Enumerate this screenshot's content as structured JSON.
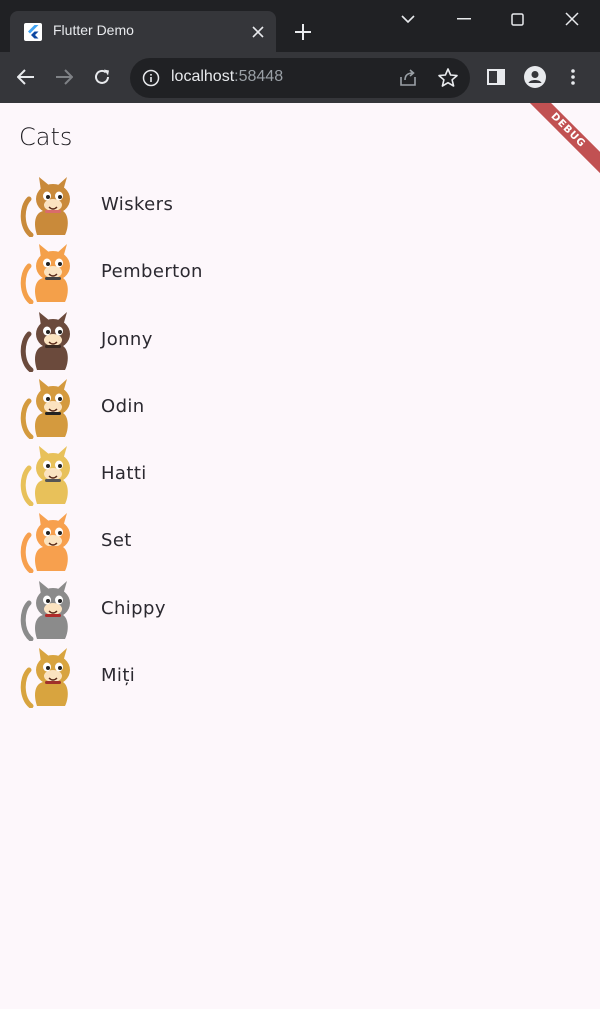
{
  "browser": {
    "tab_title": "Flutter Demo",
    "url_host": "localhost",
    "url_port": ":58448",
    "colors": {
      "frame": "#202124",
      "toolbar": "#35363a",
      "text": "#e8eaed"
    }
  },
  "app": {
    "title": "Cats",
    "debug_banner": "DEBUG",
    "cats": [
      {
        "name": "Wiskers",
        "color": "#c98a3a",
        "accent": "#d96c6c"
      },
      {
        "name": "Pemberton",
        "color": "#f4a04a",
        "accent": "#444444"
      },
      {
        "name": "Jonny",
        "color": "#6b4a3c",
        "accent": "#3a2a22"
      },
      {
        "name": "Odin",
        "color": "#d49a3e",
        "accent": "#222222"
      },
      {
        "name": "Hatti",
        "color": "#e8c15a",
        "accent": "#555555"
      },
      {
        "name": "Set",
        "color": "#f7a04e",
        "accent": "#f7a04e"
      },
      {
        "name": "Chippy",
        "color": "#8b8b8b",
        "accent": "#b02a2a"
      },
      {
        "name": "Miți",
        "color": "#d8a43f",
        "accent": "#a0302a"
      }
    ]
  }
}
